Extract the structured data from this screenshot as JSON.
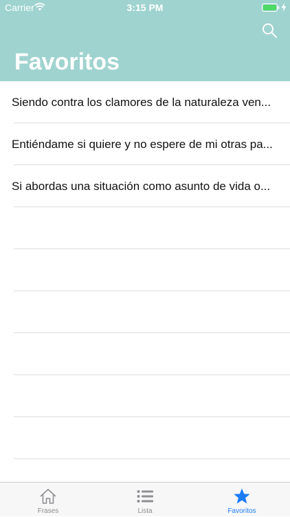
{
  "status_bar": {
    "carrier": "Carrier",
    "time": "3:15 PM"
  },
  "header": {
    "title": "Favoritos",
    "background_color": "#9fd3cf",
    "search_icon": "search-icon"
  },
  "list": {
    "items": [
      {
        "text": "Siendo contra los clamores de la naturaleza ven..."
      },
      {
        "text": "Entiéndame si quiere y no espere de mi otras pa..."
      },
      {
        "text": "Si abordas una situación como asunto de vida o..."
      },
      {
        "text": ""
      },
      {
        "text": ""
      },
      {
        "text": ""
      },
      {
        "text": ""
      },
      {
        "text": ""
      },
      {
        "text": ""
      },
      {
        "text": ""
      }
    ]
  },
  "tab_bar": {
    "active_color": "#1a7cf6",
    "inactive_color": "#8e8e93",
    "tabs": [
      {
        "label": "Frases",
        "icon": "house-icon"
      },
      {
        "label": "Lista",
        "icon": "list-icon"
      },
      {
        "label": "Favoritos",
        "icon": "star-icon"
      }
    ],
    "selected": "Favoritos"
  }
}
